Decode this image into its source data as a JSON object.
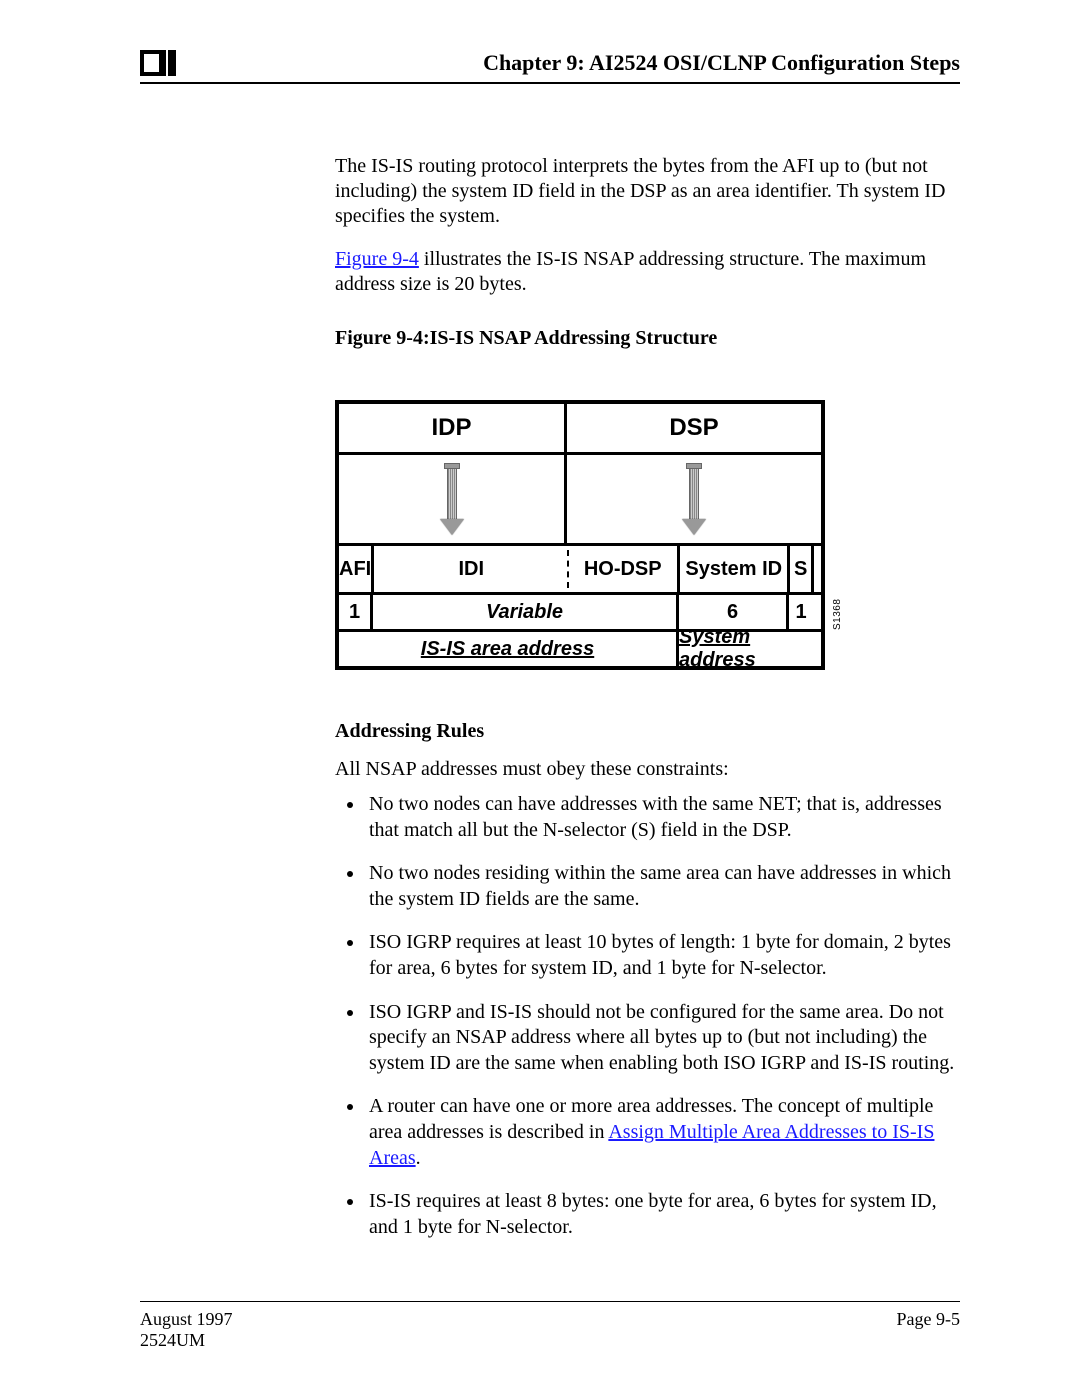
{
  "header": {
    "chapter_title": "Chapter 9: AI2524 OSI/CLNP Configuration Steps"
  },
  "body": {
    "p1": "The IS-IS routing protocol interprets the bytes from the AFI up to (but not including) the system ID field in the DSP as an area identifier. Th system ID specifies the system.",
    "p2_lead_link": "Figure 9-4",
    "p2_rest": " illustrates the IS-IS NSAP addressing structure. The maximum address size is 20 bytes.",
    "fig_caption": "Figure 9-4:IS-IS NSAP Addressing Structure"
  },
  "figure": {
    "idp": "IDP",
    "dsp": "DSP",
    "afi": "AFI",
    "idi": "IDI",
    "hodsp": "HO-DSP",
    "system_id": "System ID",
    "s": "S",
    "one": "1",
    "variable": "Variable",
    "six": "6",
    "one2": "1",
    "isis_area": "IS-IS area address",
    "sys_addr": "System address",
    "side_code": "S1368"
  },
  "rules": {
    "heading": "Addressing Rules",
    "intro": "All NSAP addresses must obey these constraints:",
    "items": [
      "No two nodes can have addresses with the same NET; that is, addresses that match all but the N-selector (S) field in the DSP.",
      "No two nodes residing within the same area can have addresses in which the system ID fields are the same.",
      "ISO IGRP requires at least 10 bytes of length: 1 byte for domain, 2 bytes for area, 6 bytes for system ID, and 1 byte for N-selector.",
      "ISO IGRP and IS-IS should not be configured for the same area. Do not specify an NSAP address where all bytes up to (but not including) the system ID are the same when enabling both ISO IGRP and IS-IS routing."
    ],
    "item5_lead": "A router can have one or more area addresses. The concept of multiple area addresses is described in ",
    "item5_link": "Assign Multiple Area Addresses to IS-IS Areas",
    "item5_tail": ".",
    "item6": "IS-IS requires at least 8 bytes: one byte for area, 6 bytes for system ID, and 1 byte for N-selector."
  },
  "footer": {
    "date": "August 1997",
    "doc": "2524UM",
    "page": "Page 9-5"
  }
}
